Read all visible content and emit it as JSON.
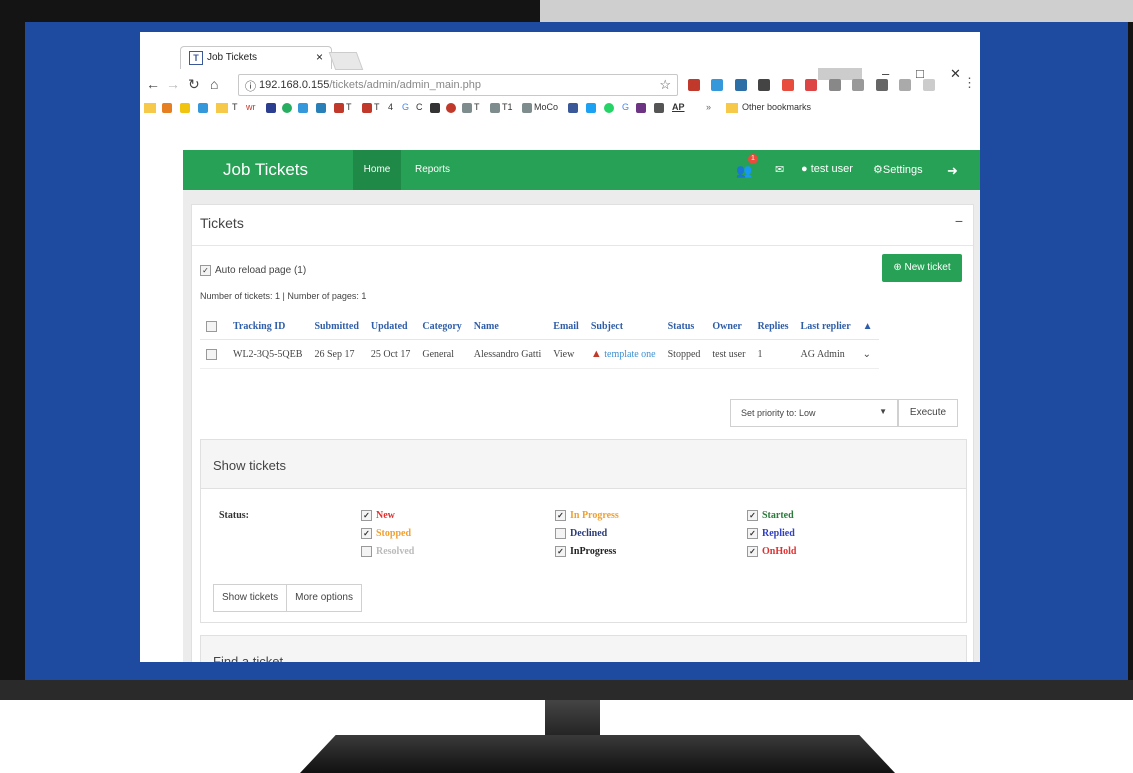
{
  "browser": {
    "tab_title": "Job Tickets",
    "tab_close": "×",
    "url_host": "192.168.0.155",
    "url_path": "/tickets/admin/admin_main.php",
    "bookmarks": [
      "T",
      "wr",
      "T",
      "T",
      "4",
      "G",
      "C",
      "T",
      "T1",
      "MoCo",
      "AP",
      "»"
    ],
    "other_bookmarks": "Other bookmarks"
  },
  "app": {
    "brand": "Job Tickets",
    "nav": {
      "home": "Home",
      "reports": "Reports"
    },
    "user_menu": {
      "user": "test user",
      "settings": "Settings"
    },
    "notif_count": "1",
    "colors": {
      "primary": "#27a155",
      "screen_bg": "#1e4aa0"
    }
  },
  "tickets_panel": {
    "title": "Tickets",
    "auto_reload": "Auto reload page (1)",
    "new_ticket": "New ticket",
    "counts": "Number of tickets: 1 | Number of pages: 1",
    "columns": [
      "Tracking ID",
      "Submitted",
      "Updated",
      "Category",
      "Name",
      "Email",
      "Subject",
      "Status",
      "Owner",
      "Replies",
      "Last replier"
    ],
    "rows": [
      {
        "tracking_id": "WL2-3Q5-5QEB",
        "submitted": "26 Sep 17",
        "updated": "25 Oct 17",
        "category": "General",
        "name": "Alessandro Gatti",
        "email": "View",
        "subject": "template one",
        "status": "Stopped",
        "owner": "test user",
        "replies": "1",
        "last_replier": "AG Admin"
      }
    ],
    "priority_select": "Set priority to: Low",
    "execute": "Execute"
  },
  "show_tickets": {
    "title": "Show tickets",
    "status_label": "Status:",
    "statuses": [
      {
        "label": "New",
        "color": "#e03030",
        "checked": true
      },
      {
        "label": "Stopped",
        "color": "#f0a030",
        "checked": true
      },
      {
        "label": "Resolved",
        "color": "#bbbbbb",
        "checked": false
      },
      {
        "label": "In Progress",
        "color": "#f0a030",
        "checked": true
      },
      {
        "label": "Declined",
        "color": "#2a3c7a",
        "checked": false
      },
      {
        "label": "InProgress",
        "color": "#222222",
        "checked": true
      },
      {
        "label": "Started",
        "color": "#2a7a3a",
        "checked": true
      },
      {
        "label": "Replied",
        "color": "#3040c0",
        "checked": true
      },
      {
        "label": "OnHold",
        "color": "#e03030",
        "checked": true
      }
    ],
    "show_button": "Show tickets",
    "more_options": "More options"
  },
  "find_ticket": {
    "title": "Find a ticket"
  }
}
